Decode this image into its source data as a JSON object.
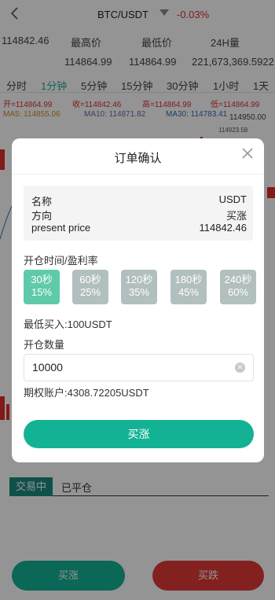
{
  "header": {
    "back_icon": "chevron-left-icon",
    "pair": "BTC/USDT",
    "change": "-0.03%",
    "colors": {
      "down": "#e02e2e",
      "accent": "#2aa6a0"
    }
  },
  "stats": {
    "last_price": "114842.46",
    "high_label": "最高价",
    "low_label": "最低价",
    "volume_label": "24H量",
    "high": "114864.99",
    "low": "114864.99",
    "volume": "221,673,369.5922"
  },
  "periods": [
    "分时",
    "1分钟",
    "5分钟",
    "15分钟",
    "30分钟",
    "1小时",
    "1天"
  ],
  "active_period": "1分钟",
  "ohlc": {
    "open": "开=114864.99",
    "close": "收=114842.46",
    "high": "高=114864.99",
    "low": "低=114864.99"
  },
  "ma": {
    "ma5": "MA5: 114855.06",
    "ma10": "MA10: 114871.82",
    "ma30": "MA30: 114783.41",
    "axis_top": "114950.00",
    "axis_label": "114923.58"
  },
  "modal": {
    "title": "订单确认",
    "close_icon": "close-icon",
    "info": [
      {
        "key": "名称",
        "value": "USDT"
      },
      {
        "key": "方向",
        "value": "买涨"
      },
      {
        "key": "present price",
        "value": "114842.46"
      }
    ],
    "period_label": "开仓时间/盈利率",
    "options": [
      {
        "time": "30秒",
        "rate": "15%"
      },
      {
        "time": "60秒",
        "rate": "25%"
      },
      {
        "time": "120秒",
        "rate": "35%"
      },
      {
        "time": "180秒",
        "rate": "45%"
      },
      {
        "time": "240秒",
        "rate": "60%"
      }
    ],
    "selected_option": "30秒",
    "min_buy": "最低买入:100USDT",
    "qty_label": "开仓数量",
    "qty_value": "10000",
    "account": "期权账户:4308.72205USDT",
    "confirm": "买涨"
  },
  "tabs": {
    "active": "交易中",
    "closed": "已平仓"
  },
  "actions": {
    "buy": "买涨",
    "sell": "买跌"
  }
}
